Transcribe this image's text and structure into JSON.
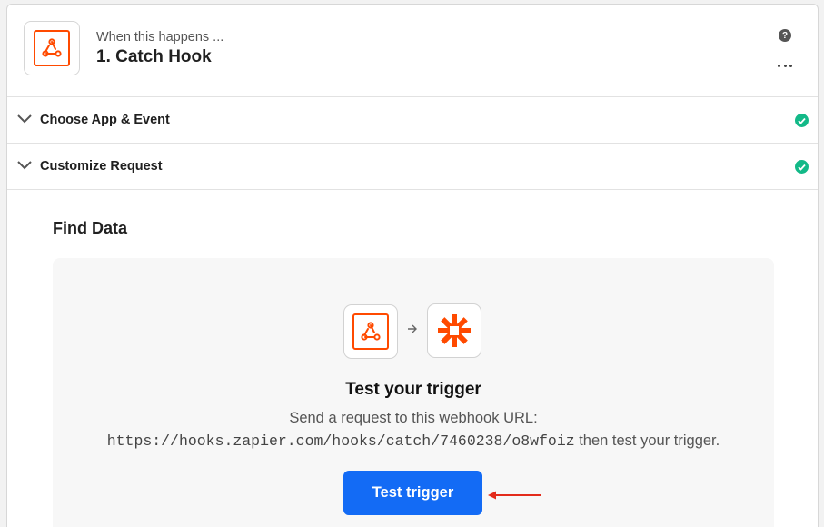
{
  "step": {
    "subtitle": "When this happens ...",
    "title": "1. Catch Hook",
    "help_glyph": "?",
    "icon": "webhook-icon"
  },
  "sections": [
    {
      "label": "Choose App & Event",
      "status": "complete"
    },
    {
      "label": "Customize Request",
      "status": "complete"
    }
  ],
  "find_data": {
    "title": "Find Data",
    "panel_title": "Test your trigger",
    "description": "Send a request to this webhook URL:",
    "webhook_url": "https://hooks.zapier.com/hooks/catch/7460238/o8wfoiz",
    "url_suffix": " then test your trigger.",
    "test_button_label": "Test trigger",
    "source_icon": "webhook-icon",
    "target_icon": "zapier-icon"
  },
  "colors": {
    "brand_orange": "#ff4a00",
    "button_blue": "#136bf5",
    "check_green": "#13b988",
    "annotation_red": "#e32b1b"
  }
}
